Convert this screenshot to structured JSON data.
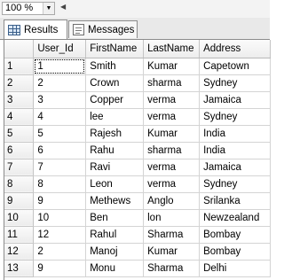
{
  "zoom": {
    "value": "100 %"
  },
  "tabs": [
    {
      "label": "Results",
      "icon": "grid-icon",
      "active": true
    },
    {
      "label": "Messages",
      "icon": "messages-icon",
      "active": false
    }
  ],
  "grid": {
    "columns": [
      "User_Id",
      "FirstName",
      "LastName",
      "Address"
    ],
    "rows": [
      {
        "num": "1",
        "cells": [
          "1",
          "Smith",
          "Kumar",
          "Capetown"
        ]
      },
      {
        "num": "2",
        "cells": [
          "2",
          "Crown",
          "sharma",
          "Sydney"
        ]
      },
      {
        "num": "3",
        "cells": [
          "3",
          "Copper",
          "verma",
          "Jamaica"
        ]
      },
      {
        "num": "4",
        "cells": [
          "4",
          "lee",
          "verma",
          "Sydney"
        ]
      },
      {
        "num": "5",
        "cells": [
          "5",
          "Rajesh",
          "Kumar",
          "India"
        ]
      },
      {
        "num": "6",
        "cells": [
          "6",
          "Rahu",
          "sharma",
          "India"
        ]
      },
      {
        "num": "7",
        "cells": [
          "7",
          "Ravi",
          "verma",
          "Jamaica"
        ]
      },
      {
        "num": "8",
        "cells": [
          "8",
          "Leon",
          "verma",
          "Sydney"
        ]
      },
      {
        "num": "9",
        "cells": [
          "9",
          "Methews",
          "Anglo",
          "Srilanka"
        ]
      },
      {
        "num": "10",
        "cells": [
          "10",
          "Ben",
          "lon",
          "Newzealand"
        ]
      },
      {
        "num": "11",
        "cells": [
          "12",
          "Rahul",
          "Sharma",
          "Bombay"
        ]
      },
      {
        "num": "12",
        "cells": [
          "2",
          "Manoj",
          "Kumar",
          "Bombay"
        ]
      },
      {
        "num": "13",
        "cells": [
          "9",
          "Monu",
          "Sharma",
          "Delhi"
        ]
      }
    ]
  }
}
